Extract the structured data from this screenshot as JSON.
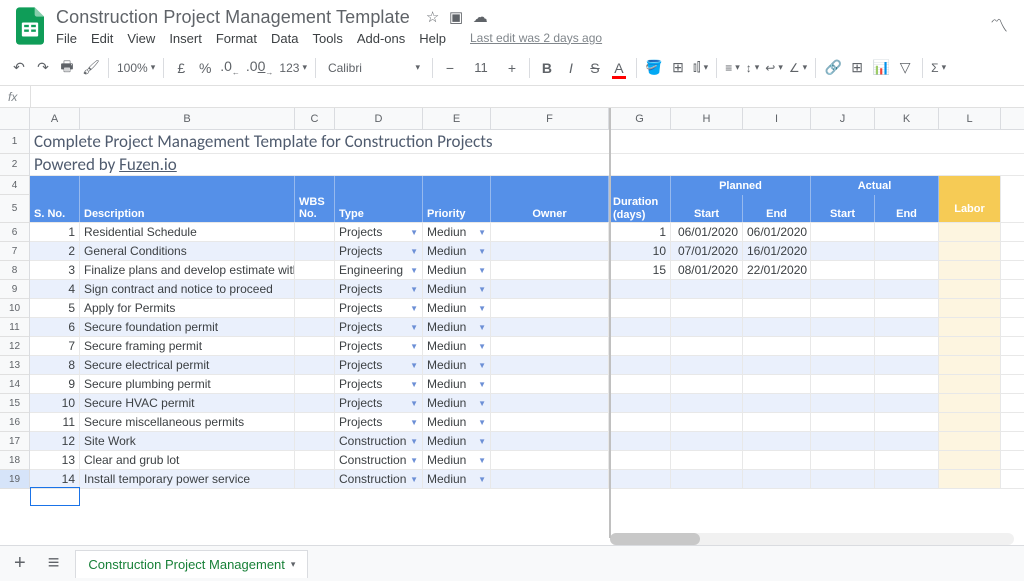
{
  "doc": {
    "title": "Construction Project Management Template",
    "last_edit": "Last edit was 2 days ago"
  },
  "menu": [
    "File",
    "Edit",
    "View",
    "Insert",
    "Format",
    "Data",
    "Tools",
    "Add-ons",
    "Help"
  ],
  "toolbar": {
    "zoom": "100%",
    "font": "Calibri",
    "size": "11",
    "currency": "£",
    "percent": "%",
    "dec_dec": ".0",
    "dec_inc": ".00",
    "num_fmt": "123"
  },
  "fx": "fx",
  "cols": [
    "A",
    "B",
    "C",
    "D",
    "E",
    "F",
    "G",
    "H",
    "I",
    "J",
    "K",
    "L"
  ],
  "row_labels": [
    "1",
    "2",
    "4",
    "5",
    "6",
    "7",
    "8",
    "9",
    "10",
    "11",
    "12",
    "13",
    "14",
    "15",
    "16",
    "17",
    "18",
    "19"
  ],
  "selected_row": "19",
  "titles": {
    "line1": "Complete Project Management Template for Construction Projects",
    "line2_prefix": "Powered by ",
    "line2_link": "Fuzen.io"
  },
  "headers": {
    "sno": "S. No.",
    "desc": "Description",
    "wbs": "WBS No.",
    "type": "Type",
    "priority": "Priority",
    "owner": "Owner",
    "duration": "Duration (days)",
    "planned": "Planned",
    "actual": "Actual",
    "start": "Start",
    "end": "End",
    "labor": "Labor"
  },
  "rows": [
    {
      "n": "1",
      "d": "Residential Schedule",
      "t": "Projects",
      "p": "Mediun",
      "dur": "1",
      "ps": "06/01/2020",
      "pe": "06/01/2020"
    },
    {
      "n": "2",
      "d": "General Conditions",
      "t": "Projects",
      "p": "Mediun",
      "dur": "10",
      "ps": "07/01/2020",
      "pe": "16/01/2020"
    },
    {
      "n": "3",
      "d": "Finalize plans and develop estimate with",
      "t": "Engineering",
      "p": "Mediun",
      "dur": "15",
      "ps": "08/01/2020",
      "pe": "22/01/2020"
    },
    {
      "n": "4",
      "d": "Sign contract and notice to proceed",
      "t": "Projects",
      "p": "Mediun"
    },
    {
      "n": "5",
      "d": "Apply for Permits",
      "t": "Projects",
      "p": "Mediun"
    },
    {
      "n": "6",
      "d": "Secure foundation permit",
      "t": "Projects",
      "p": "Mediun"
    },
    {
      "n": "7",
      "d": "Secure framing permit",
      "t": "Projects",
      "p": "Mediun"
    },
    {
      "n": "8",
      "d": "Secure electrical permit",
      "t": "Projects",
      "p": "Mediun"
    },
    {
      "n": "9",
      "d": "Secure plumbing permit",
      "t": "Projects",
      "p": "Mediun"
    },
    {
      "n": "10",
      "d": "Secure HVAC permit",
      "t": "Projects",
      "p": "Mediun"
    },
    {
      "n": "11",
      "d": "Secure miscellaneous permits",
      "t": "Projects",
      "p": "Mediun"
    },
    {
      "n": "12",
      "d": "Site Work",
      "t": "Construction",
      "p": "Mediun"
    },
    {
      "n": "13",
      "d": "Clear and grub lot",
      "t": "Construction",
      "p": "Mediun"
    },
    {
      "n": "14",
      "d": "Install temporary power service",
      "t": "Construction",
      "p": "Mediun"
    }
  ],
  "sheet": {
    "name": "Construction Project Management"
  }
}
